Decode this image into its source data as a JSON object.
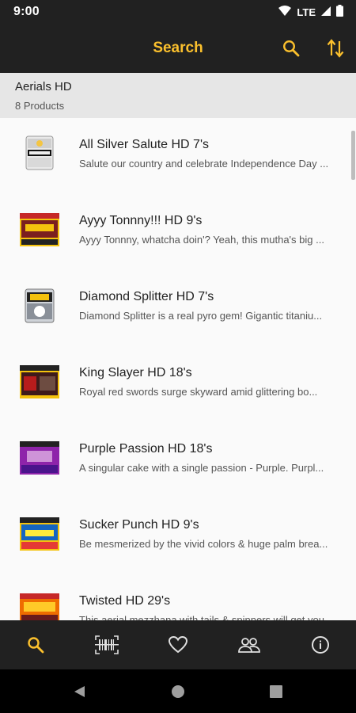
{
  "status_bar": {
    "time": "9:00",
    "network": "LTE",
    "icons": [
      "wifi-icon",
      "signal-icon",
      "battery-icon"
    ]
  },
  "app_bar": {
    "title": "Search",
    "actions": [
      "search-icon",
      "sort-icon"
    ],
    "accent": "#fbc02d",
    "background": "#212121"
  },
  "section": {
    "name": "Aerials HD",
    "count": "8 Products"
  },
  "products": [
    {
      "title": "All Silver Salute HD 7's",
      "description": "Salute our country and celebrate Independence Day ..."
    },
    {
      "title": "Ayyy Tonnny!!! HD 9's",
      "description": "Ayyy Tonnny, whatcha doin'?  Yeah, this mutha's big ..."
    },
    {
      "title": "Diamond Splitter HD 7's",
      "description": "Diamond Splitter is a real pyro gem!  Gigantic titaniu..."
    },
    {
      "title": "King Slayer HD 18's",
      "description": "Royal red swords surge skyward amid glittering bo..."
    },
    {
      "title": "Purple Passion HD 18's",
      "description": "A singular cake with a single passion - Purple.  Purpl..."
    },
    {
      "title": "Sucker Punch HD 9's",
      "description": "Be mesmerized by the vivid colors & huge palm brea..."
    },
    {
      "title": "Twisted HD 29's",
      "description": "This aerial mezzhana with tails & spinners will get you..."
    }
  ],
  "bottom_nav": [
    "search-icon",
    "barcode-icon",
    "heart-icon",
    "group-icon",
    "info-icon"
  ],
  "system_nav": [
    "back-icon",
    "home-icon",
    "recents-icon"
  ]
}
